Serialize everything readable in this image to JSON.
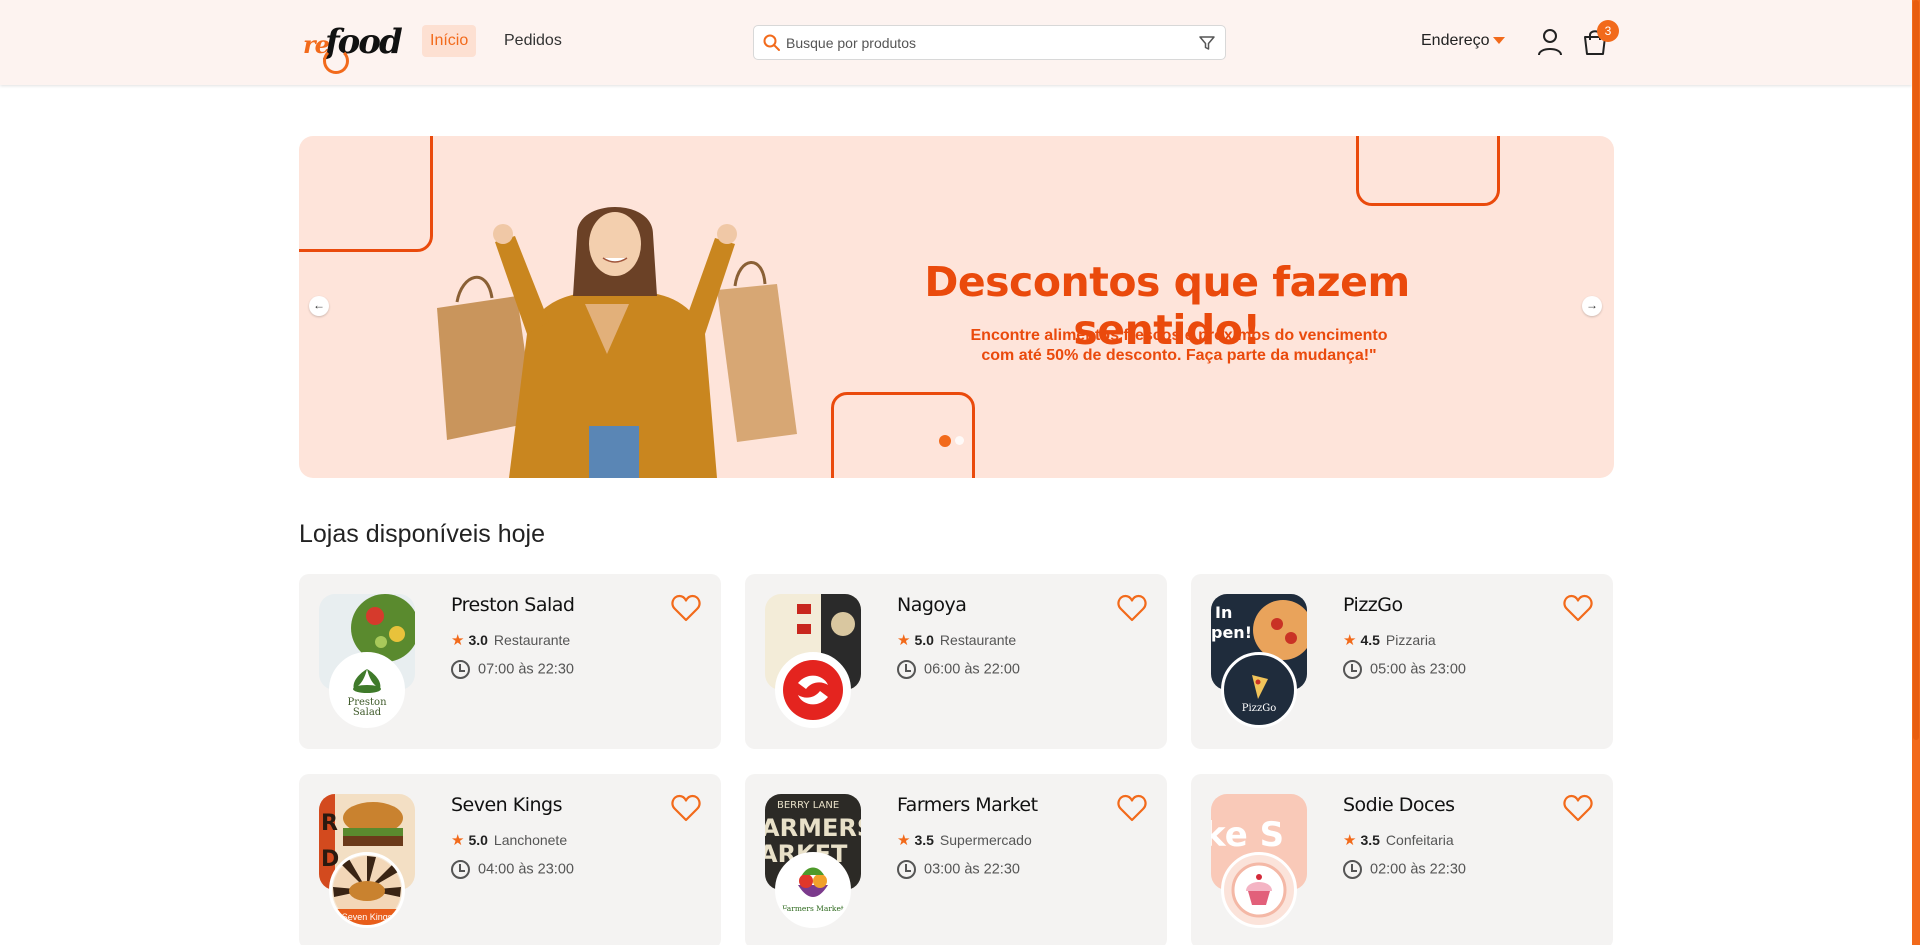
{
  "header": {
    "logo_re": "re",
    "logo_food": "food",
    "nav": [
      {
        "label": "Início",
        "active": true
      },
      {
        "label": "Pedidos",
        "active": false
      }
    ],
    "search_placeholder": "Busque por produtos",
    "address_label": "Endereço",
    "cart_count": "3"
  },
  "banner": {
    "headline": "Descontos que fazem sentido!",
    "subline_1": "Encontre alimentos frescos e próximos do vencimento",
    "subline_2": "com até 50% de desconto. Faça parte da mudança!\"",
    "slide_count": 2,
    "active_slide": 1
  },
  "section": {
    "title": "Lojas disponíveis hoje"
  },
  "stores": [
    {
      "name": "Preston Salad",
      "rating": "3.0",
      "category": "Restaurante",
      "hours": "07:00 às 22:30",
      "logo_text": "Preston Salad"
    },
    {
      "name": "Nagoya",
      "rating": "5.0",
      "category": "Restaurante",
      "hours": "06:00 às 22:00",
      "logo_text": ""
    },
    {
      "name": "PizzGo",
      "rating": "4.5",
      "category": "Pizzaria",
      "hours": "05:00 às 23:00",
      "logo_text": "PizzGo"
    },
    {
      "name": "Seven Kings",
      "rating": "5.0",
      "category": "Lanchonete",
      "hours": "04:00 às 23:00",
      "logo_text": "Seven Kings"
    },
    {
      "name": "Farmers Market",
      "rating": "3.5",
      "category": "Supermercado",
      "hours": "03:00 às 22:30",
      "logo_text": "Farmers Market"
    },
    {
      "name": "Sodie Doces",
      "rating": "3.5",
      "category": "Confeitaria",
      "hours": "02:00 às 22:30",
      "logo_text": ""
    }
  ],
  "colors": {
    "accent": "#f26a1b",
    "banner_bg": "#fee4da",
    "header_bg": "#fdf3f0",
    "card_bg": "#f4f3f2"
  }
}
